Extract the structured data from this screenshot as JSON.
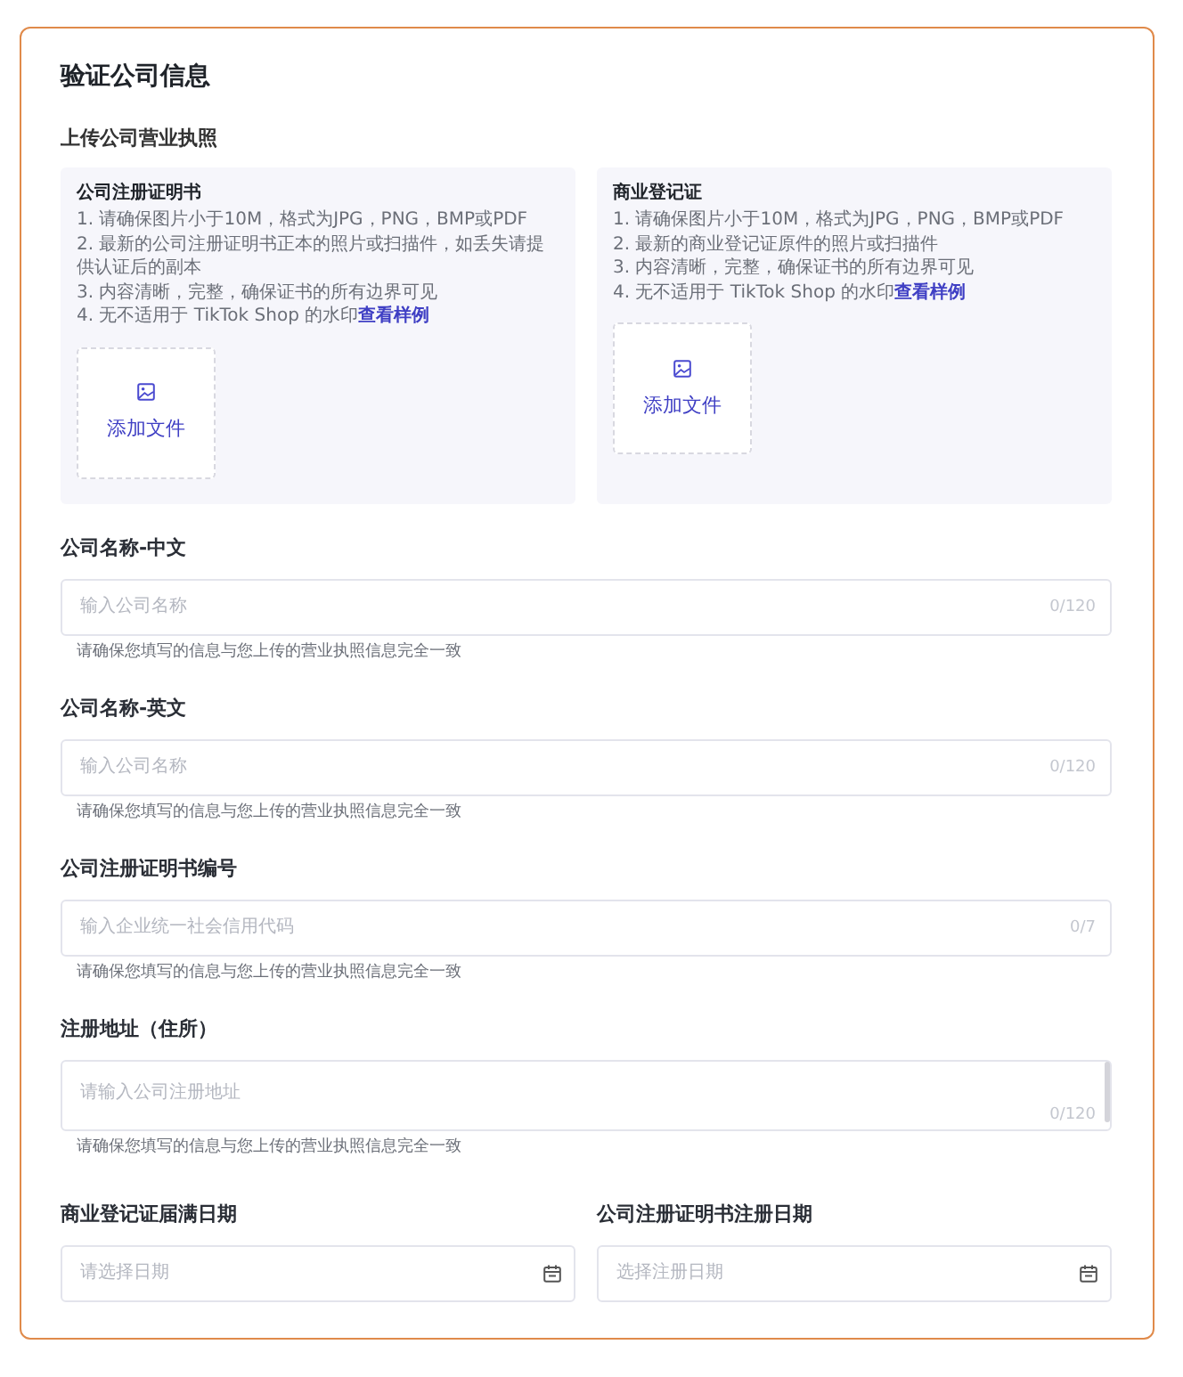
{
  "title": "验证公司信息",
  "upload_section": {
    "heading": "上传公司营业执照",
    "panels": [
      {
        "title": "公司注册证明书",
        "requirements": [
          {
            "text": "1. 请确保图片小于10M，格式为JPG，PNG，BMP或PDF"
          },
          {
            "text": "2. 最新的公司注册证明书正本的照片或扫描件，如丢失请提供认证后的副本"
          },
          {
            "text": "3. 内容清晰，完整，确保证书的所有边界可见"
          },
          {
            "text": "4. 无不适用于 TikTok Shop 的水印",
            "link": "查看样例"
          }
        ],
        "upload_label": "添加文件"
      },
      {
        "title": "商业登记证",
        "requirements": [
          {
            "text": "1. 请确保图片小于10M，格式为JPG，PNG，BMP或PDF"
          },
          {
            "text": "2. 最新的商业登记证原件的照片或扫描件"
          },
          {
            "text": "3. 内容清晰，完整，确保证书的所有边界可见"
          },
          {
            "text": "4. 无不适用于 TikTok Shop 的水印",
            "link": "查看样例"
          }
        ],
        "upload_label": "添加文件"
      }
    ]
  },
  "fields": [
    {
      "kind": "input",
      "label": "公司名称-中文",
      "placeholder": "输入公司名称",
      "counter": "0/120",
      "hint": "请确保您填写的信息与您上传的营业执照信息完全一致"
    },
    {
      "kind": "input",
      "label": "公司名称-英文",
      "placeholder": "输入公司名称",
      "counter": "0/120",
      "hint": "请确保您填写的信息与您上传的营业执照信息完全一致"
    },
    {
      "kind": "input",
      "label": "公司注册证明书编号",
      "placeholder": "输入企业统一社会信用代码",
      "counter": "0/7",
      "hint": "请确保您填写的信息与您上传的营业执照信息完全一致"
    },
    {
      "kind": "textarea",
      "label": "注册地址（住所）",
      "placeholder": "请输入公司注册地址",
      "counter": "0/120",
      "hint": "请确保您填写的信息与您上传的营业执照信息完全一致"
    }
  ],
  "date_fields": [
    {
      "label": "商业登记证届满日期",
      "placeholder": "请选择日期"
    },
    {
      "label": "公司注册证明书注册日期",
      "placeholder": "选择注册日期"
    }
  ]
}
